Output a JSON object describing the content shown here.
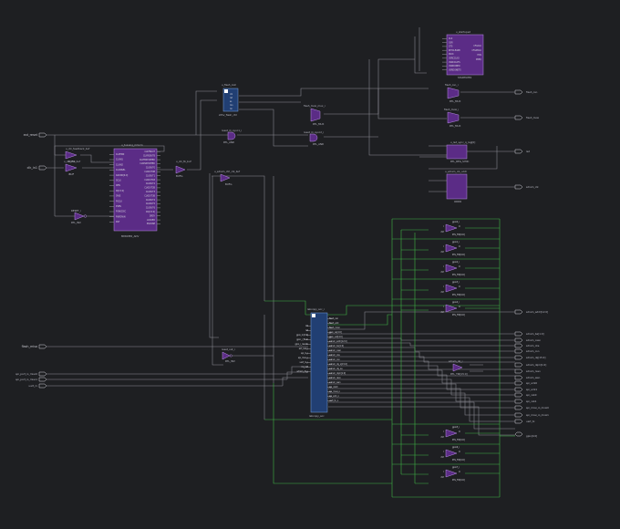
{
  "colors": {
    "background": "#1e1f22",
    "wire": "#8d8d95",
    "highlighted_wire": "#3fb447",
    "cell_fill": "#5b2c86",
    "cell_stroke": "#b58be0",
    "selected_cell_fill": "#213f73",
    "text": "#c8c8d0"
  },
  "icons": {
    "port": "input-output-port-icon",
    "inverter": "inverter-gate-icon",
    "buffer": "buffer-gate-icon"
  },
  "input_ports": {
    "ext_reset": "ext_reset",
    "clk_in1": "clk_in1",
    "flash_miso": "flash_miso",
    "spi_port_in_0": "spi_port_io_miso0",
    "spi_port_in_1": "spi_port_io_miso1",
    "uart_rx": "uart_rx"
  },
  "output_ports": {
    "flash_csn": "flash_csn",
    "flash_mosi": "flash_mosi",
    "led": "led",
    "sdram_clk": "sdram_clk",
    "sdram_addr": "sdram_addr[12:0]",
    "sdram_ba": "sdram_ba[1:0]",
    "sdram_casn": "sdram_casn",
    "sdram_cke": "sdram_cke",
    "sdram_csn": "sdram_csn",
    "sdram_dq": "sdram_dq[15:0]",
    "sdram_dqm": "sdram_dqm[1:0]",
    "sdram_rasn": "sdram_rasn",
    "sdram_wen": "sdram_wen",
    "spi_sclk0": "spi_sclk0",
    "spi_sclk1": "spi_sclk1",
    "spi_csb0": "spi_csb0",
    "spi_csb1": "spi_csb1",
    "spi_mosi_io_mosi0": "spi_mosi_io_mosi0",
    "spi_mosi_io_mosi1": "spi_mosi_io_mosi1",
    "uart_tx": "uart_tx",
    "gpio": "gpio[4:0]"
  },
  "cells": {
    "clk_fb_buf": {
      "name": "u_clk_feedback_buf",
      "type": "BUFG"
    },
    "clk_in1_buf": {
      "name": "u_clk_in1_buf",
      "type": "IBUF"
    },
    "mmcm": {
      "name": "u_tuxsing_mmcm",
      "type": "MMCME2_ADV",
      "pins_left": [
        "CLKFBIN",
        "CLKIN1",
        "CLKIN2",
        "CLKINSEL",
        "DADDR[6:0]",
        "DCLK",
        "DEN",
        "DI[15:0]",
        "DWE",
        "PSCLK",
        "PSEN",
        "PSINCDEC",
        "PWRDWN",
        "RST"
      ],
      "pins_right": [
        "CLKFBOUT",
        "CLKFBOUTB",
        "CLKFBSTOPPED",
        "CLKINSTOPPED",
        "CLKOUT0",
        "CLKOUT0B",
        "CLKOUT1",
        "CLKOUT1B",
        "CLKOUT2",
        "CLKOUT2B",
        "CLKOUT3",
        "CLKOUT3B",
        "CLKOUT4",
        "CLKOUT5",
        "CLKOUT6",
        "DO[15:0]",
        "DRDY",
        "LOCKED",
        "PSDONE"
      ]
    },
    "rst_inv": {
      "name": "RESET_i",
      "type": "RTL_INV"
    },
    "clk_buf": {
      "name": "u_clk_fb_buf",
      "type": "BUFG"
    },
    "flash_inst": {
      "name": "u_flash_inst",
      "type": "s55v_flash_ctrl",
      "pins": [
        "clk",
        "rst",
        "ss",
        "mo",
        "mi"
      ]
    },
    "async1": {
      "name": "reset_m_sync1_i",
      "type": "RTL_AND"
    },
    "async2": {
      "name": "reset_m_sync2_i",
      "type": "RTL_AND"
    },
    "flash_mux": {
      "name": "flash_mosi_mux_i",
      "type": "RTL_MUX"
    },
    "sdram_clk_buf": {
      "name": "u_sdram_ctrl_clk_buf",
      "type": "BUFG"
    },
    "reset_out": {
      "name": "reset_out_i",
      "type": "RTL_INV"
    },
    "soc": {
      "name": "lebonpy_soc_i",
      "type": "lebonpy_soc",
      "pins_left": [
        "clk",
        "rst",
        "gpio_in[4:0]",
        "gpio_i_flash",
        "gpio_i_resetn",
        "ext_inst_i",
        "spi_in_i",
        "spi_miso_i",
        "uart_rx_i",
        "irq_ext",
        "sdram_dq_i"
      ],
      "pins_right": [
        "flash_csn",
        "flash_sclk",
        "flash_mosi",
        "gpio_oe[4:0]",
        "gpio_out[4:0]",
        "sdram_addr[12:0]",
        "sdram_ba[1:0]",
        "sdram_casn",
        "sdram_cke",
        "sdram_csn",
        "sdram_dq_o[15:0]",
        "sdram_dq_oe",
        "sdram_dqm[1:0]",
        "sdram_rasn",
        "sdram_wen",
        "spi_csb0",
        "spi_mosi_o",
        "spi_sclk_o",
        "uart_tx_o"
      ]
    },
    "startup": {
      "name": "u_startupe2",
      "type": "STARTUPE2",
      "pins_left": [
        "CLK",
        "GSR",
        "GTS",
        "KEYCLEARB",
        "PACK",
        "USRCCLKO",
        "USRCCLKTS",
        "USRDONEO",
        "USRDONETS"
      ],
      "pins_right": [
        "CFGCLK",
        "CFGMCLK",
        "EOS",
        "PREQ"
      ]
    },
    "flash_csn_i": {
      "name": "flash_csn_i",
      "type": "RTL_MUX"
    },
    "flash_mosi_i": {
      "name": "flash_mosi_i",
      "type": "RTL_MUX"
    },
    "led_reg": {
      "name": "u_led_sync_q_reg[0]",
      "type": "RTL_REG_SYNC"
    },
    "sdram_clk_oddr": {
      "name": "u_sdram_clk_oddr",
      "type": "ODDR"
    },
    "sdram_dq_buf": {
      "name": "sdram_dq_i",
      "type": "RTL_TRISTATE",
      "label": "RTL_TRI[15:0]"
    },
    "tri_pin_in": "I",
    "tri_pin_en": "ctrl",
    "tri_pin_out": "O",
    "gpio_tri_top": [
      {
        "name": "gpio0_i",
        "type": "RTL_TRI[4:0]"
      },
      {
        "name": "gpio1_i",
        "type": "RTL_TRI[4:0]"
      },
      {
        "name": "gpio2_i",
        "type": "RTL_TRI[4:0]"
      },
      {
        "name": "gpio3_i",
        "type": "RTL_TRI[4:0]"
      },
      {
        "name": "gpio4_i",
        "type": "RTL_TRI[4:0]"
      }
    ],
    "gpio_tri_bottom": [
      {
        "name": "gpio5_i",
        "type": "RTL_TRI[4:0]"
      },
      {
        "name": "gpio6_i",
        "type": "RTL_TRI[4:0]"
      },
      {
        "name": "gpio7_i",
        "type": "RTL_TRI[4:0]"
      }
    ]
  }
}
